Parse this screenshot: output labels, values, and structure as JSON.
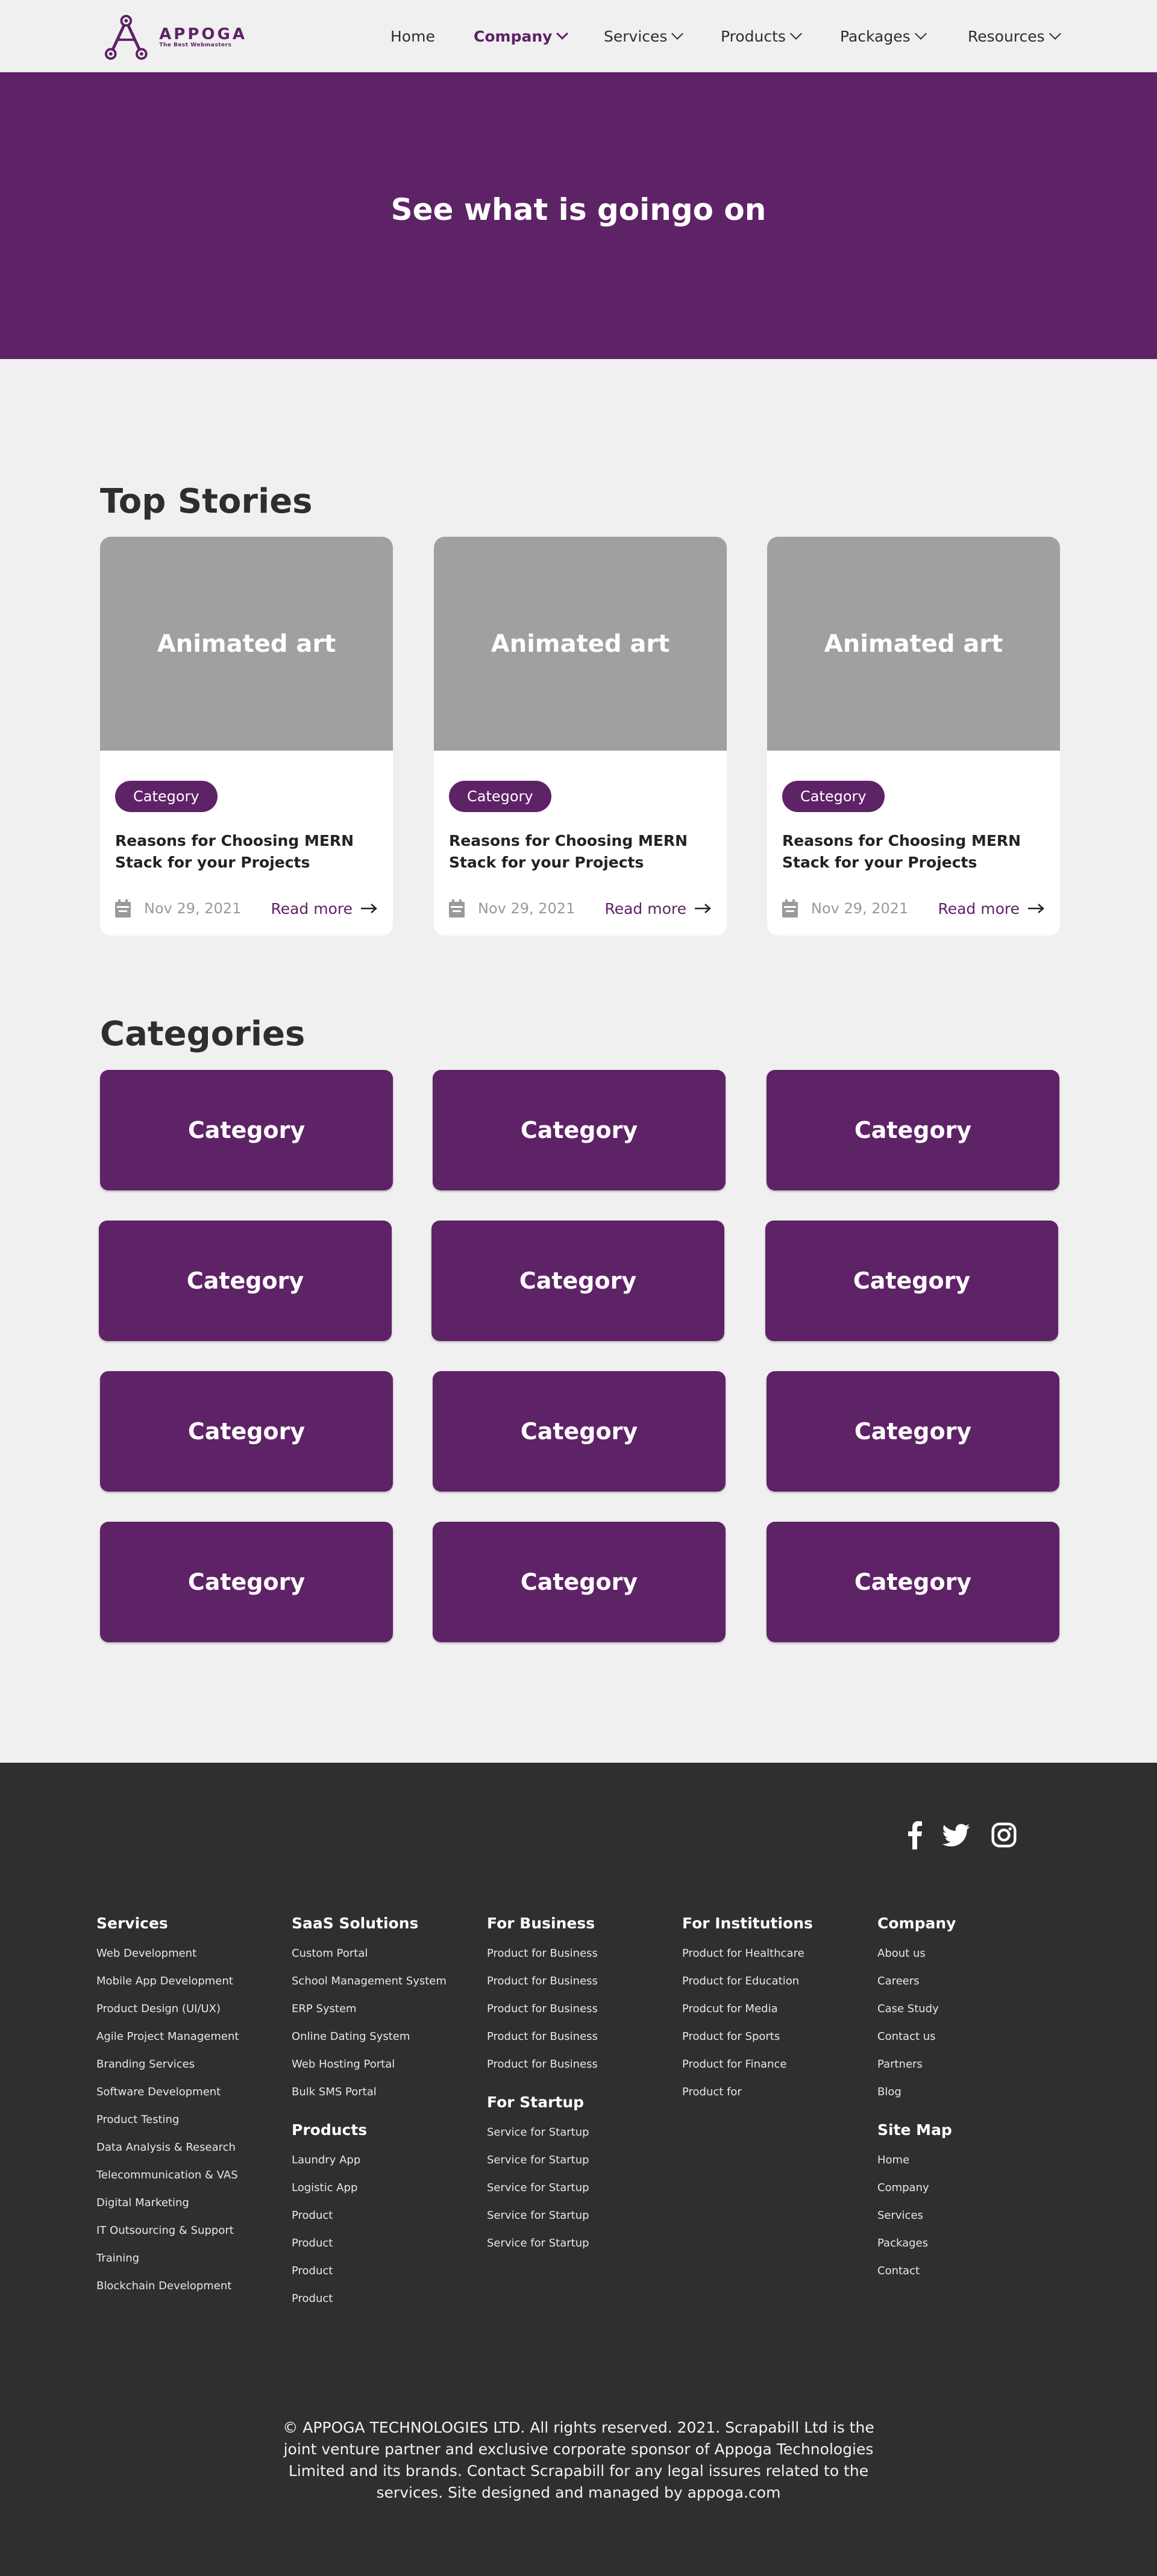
{
  "brand": {
    "name": "APPOGA",
    "tagline": "The Best Webmasters",
    "accent": "#5e2266"
  },
  "nav": [
    {
      "label": "Home",
      "active": false,
      "dropdown": false
    },
    {
      "label": "Company",
      "active": true,
      "dropdown": true
    },
    {
      "label": "Services",
      "active": false,
      "dropdown": true
    },
    {
      "label": "Products",
      "active": false,
      "dropdown": true
    },
    {
      "label": "Packages",
      "active": false,
      "dropdown": true
    },
    {
      "label": "Resources",
      "active": false,
      "dropdown": true
    }
  ],
  "hero": {
    "title": "See what is goingo  on"
  },
  "top_stories": {
    "title": "Top Stories",
    "cards": [
      {
        "image_label": "Animated art",
        "category": "Category",
        "title": "Reasons for Choosing MERN Stack for your Projects",
        "date": "Nov 29, 2021",
        "read_more": "Read more"
      },
      {
        "image_label": "Animated art",
        "category": "Category",
        "title": "Reasons for Choosing MERN Stack for your Projects",
        "date": "Nov 29, 2021",
        "read_more": "Read more"
      },
      {
        "image_label": "Animated art",
        "category": "Category",
        "title": "Reasons for Choosing MERN Stack for your Projects",
        "date": "Nov 29, 2021",
        "read_more": "Read more"
      }
    ]
  },
  "categories": {
    "title": "Categories",
    "items": [
      "Category",
      "Category",
      "Category",
      "Category",
      "Category",
      "Category",
      "Category",
      "Category",
      "Category",
      "Category",
      "Category",
      "Category"
    ]
  },
  "footer": {
    "social": [
      "facebook-icon",
      "twitter-icon",
      "instagram-icon"
    ],
    "services": {
      "title": "Services",
      "links": [
        "Web Development",
        "Mobile App Development",
        "Product Design (UI/UX)",
        "Agile Project Management",
        "Branding Services",
        "Software Development",
        "Product Testing",
        "Data Analysis & Research",
        "Telecommunication & VAS",
        "Digital Marketing",
        "IT Outsourcing & Support",
        "Training",
        "Blockchain Development"
      ]
    },
    "saas": {
      "title": "SaaS Solutions",
      "links": [
        "Custom Portal",
        "School Management System",
        "ERP System",
        "Online Dating System",
        "Web Hosting Portal",
        "Bulk SMS Portal"
      ]
    },
    "products": {
      "title": "Products",
      "links": [
        "Laundry App",
        "Logistic App",
        "Product",
        "Product",
        "Product",
        "Product"
      ]
    },
    "business": {
      "title": "For Business",
      "links": [
        "Product for Business",
        "Product for Business",
        "Product for Business",
        "Product for Business",
        "Product for Business"
      ]
    },
    "startup": {
      "title": "For Startup",
      "links": [
        "Service for Startup",
        "Service for Startup",
        "Service for Startup",
        "Service for Startup",
        "Service for Startup"
      ]
    },
    "institutions": {
      "title": "For Institutions",
      "links": [
        "Product for Healthcare",
        "Product for Education",
        "Prodcut for Media",
        "Product for Sports",
        "Product for Finance",
        "Product for"
      ]
    },
    "company": {
      "title": "Company",
      "links": [
        "About us",
        "Careers",
        "Case Study",
        "Contact us",
        "Partners",
        "Blog"
      ]
    },
    "sitemap": {
      "title": "Site Map",
      "links": [
        "Home",
        "Company",
        "Services",
        "Packages",
        "Contact"
      ]
    },
    "copyright": "© APPOGA TECHNOLOGIES LTD. All rights reserved. 2021. Scrapabill Ltd is the joint venture partner and exclusive corporate sponsor of Appoga Technologies Limited and its brands. Contact Scrapabill for any legal issures related to the services. Site designed and managed by appoga.com"
  }
}
